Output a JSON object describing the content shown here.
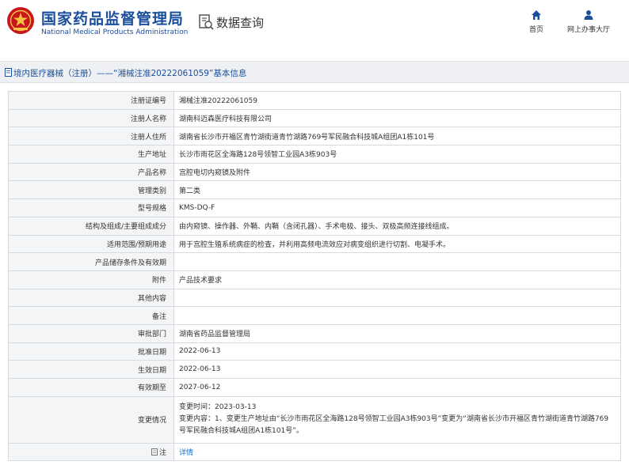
{
  "header": {
    "site_title": "国家药品监督管理局",
    "site_subtitle": "National Medical Products Administration",
    "query_title": "数据查询",
    "nav": {
      "home": "首页",
      "online_hall": "网上办事大厅"
    }
  },
  "title_bar": {
    "text": "境内医疗器械（注册）——“湘械注准20222061059”基本信息"
  },
  "fields": [
    {
      "label": "注册证编号",
      "value": "湘械注准20222061059"
    },
    {
      "label": "注册人名称",
      "value": "湖南科迈森医疗科技有限公司"
    },
    {
      "label": "注册人住所",
      "value": "湖南省长沙市开福区青竹湖街道青竹湖路769号军民融合科技城A组团A1栋101号"
    },
    {
      "label": "生产地址",
      "value": "长沙市雨花区全海路128号领智工业园A3栋903号"
    },
    {
      "label": "产品名称",
      "value": "宫腔电切内窥镜及附件"
    },
    {
      "label": "管理类别",
      "value": "第二类"
    },
    {
      "label": "型号规格",
      "value": "KMS-DQ-F"
    },
    {
      "label": "结构及组成/主要组成成分",
      "value": "由内窥镜、操作器、外鞘、内鞘（含闭孔器）、手术电极、接头、双极高频连接线组成。"
    },
    {
      "label": "适用范围/预期用途",
      "value": "用于宫腔生殖系统病症的检查，并利用高频电流效应对病变组织进行切割、电凝手术。"
    },
    {
      "label": "产品储存条件及有效期",
      "value": ""
    },
    {
      "label": "附件",
      "value": "产品技术要求"
    },
    {
      "label": "其他内容",
      "value": ""
    },
    {
      "label": "备注",
      "value": ""
    },
    {
      "label": "审批部门",
      "value": "湖南省药品监督管理局"
    },
    {
      "label": "批准日期",
      "value": "2022-06-13"
    },
    {
      "label": "生效日期",
      "value": "2022-06-13"
    },
    {
      "label": "有效期至",
      "value": "2027-06-12"
    }
  ],
  "change": {
    "label": "变更情况",
    "lines": [
      "变更时间：2023-03-13",
      "变更内容：1、变更生产地址由“长沙市雨花区全海路128号领智工业园A3栋903号”变更为“湖南省长沙市开福区青竹湖街道青竹湖路769号军民融合科技城A组团A1栋101号”。"
    ]
  },
  "note_row": {
    "label": "注",
    "link": "详情"
  },
  "colors": {
    "brand_blue": "#1b4f9b",
    "logo_red": "#c8161d",
    "link_blue": "#1b6fc7",
    "label_bg": "#f4f5f7",
    "border": "#d6dbe1"
  },
  "icons": [
    "emblem-logo",
    "search-document-icon",
    "home-icon",
    "user-icon",
    "document-icon",
    "note-icon"
  ]
}
